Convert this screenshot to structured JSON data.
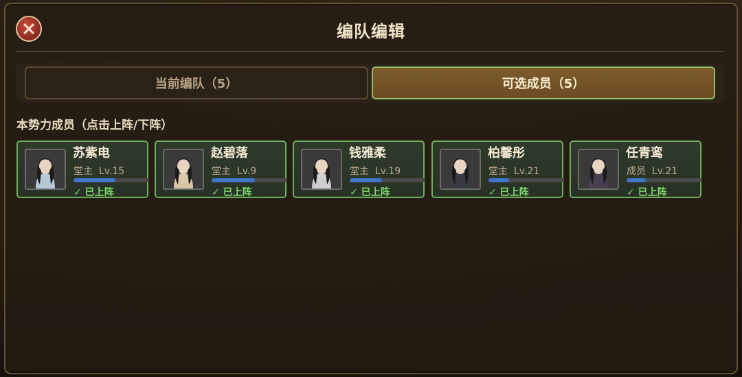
{
  "title": "编队编辑",
  "tabs": [
    {
      "label": "当前编队（5）",
      "active": false
    },
    {
      "label": "可选成员（5）",
      "active": true
    }
  ],
  "section_label": "本势力成员（点击上阵/下阵）",
  "members": [
    {
      "name": "苏紫电",
      "role": "堂主",
      "level": "Lv.15",
      "progress": 0.55,
      "status": "✓ 已上阵"
    },
    {
      "name": "赵碧落",
      "role": "堂主",
      "level": "Lv.9",
      "progress": 0.57,
      "status": "✓ 已上阵"
    },
    {
      "name": "钱雅柔",
      "role": "堂主",
      "level": "Lv.19",
      "progress": 0.43,
      "status": "✓ 已上阵"
    },
    {
      "name": "柏馨彤",
      "role": "堂主",
      "level": "Lv.21",
      "progress": 0.27,
      "status": "✓ 已上阵"
    },
    {
      "name": "任青鸾",
      "role": "成员",
      "level": "Lv.21",
      "progress": 0.25,
      "status": "✓ 已上阵"
    }
  ],
  "colors": {
    "accent_green": "#6fae5a",
    "status_green": "#7fd86a",
    "progress_blue": "#3f74c9",
    "active_tab": "#7d5b2b",
    "close_red": "#c94a3c"
  },
  "icons": {
    "close": "close-icon",
    "portrait": "portrait-icon"
  }
}
